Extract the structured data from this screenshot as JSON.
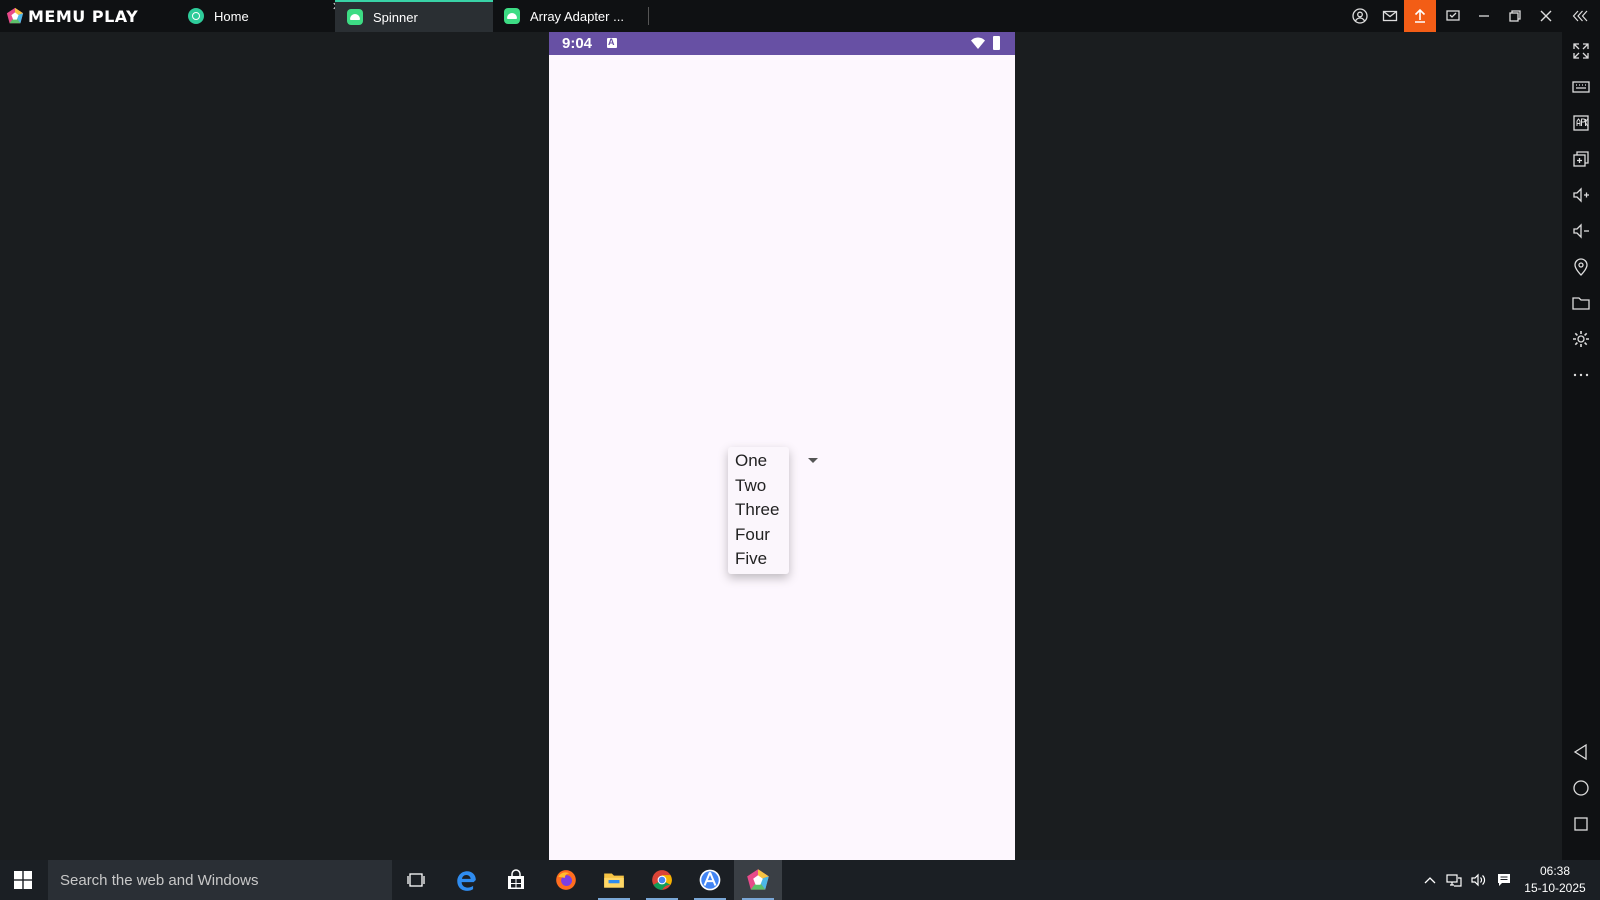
{
  "app": {
    "brand": "MEMU PLAY"
  },
  "tabs": [
    {
      "label": "Home",
      "active": false
    },
    {
      "label": "Spinner",
      "active": true
    },
    {
      "label": "Array Adapter ...",
      "active": false
    }
  ],
  "tab_close_glyph": "✕",
  "colors": {
    "status_bar": "#6750a4",
    "phone_bg": "#fdf7fe",
    "upload_button": "#f35d16",
    "active_tab_accent": "#39d3a7"
  },
  "phone": {
    "status": {
      "time": "9:04"
    },
    "spinner": {
      "options": [
        "One",
        "Two",
        "Three",
        "Four",
        "Five"
      ]
    }
  },
  "taskbar": {
    "search_placeholder": "Search the web and Windows",
    "clock_time": "06:38",
    "clock_date": "15-10-2025"
  }
}
